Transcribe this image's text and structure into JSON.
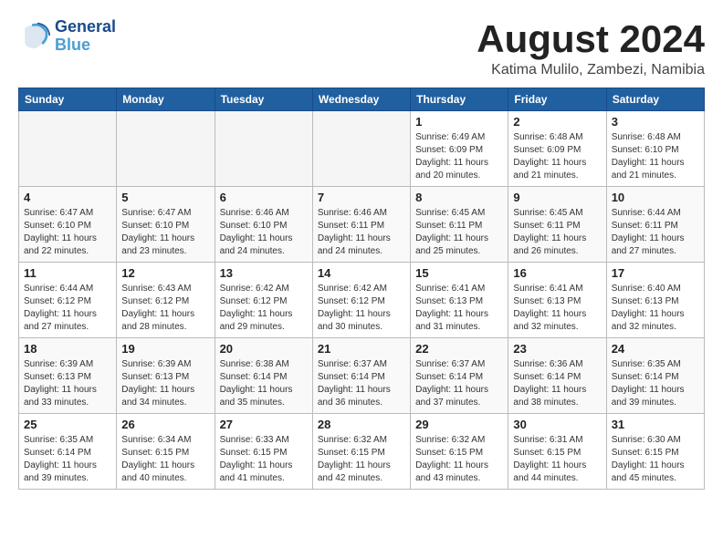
{
  "header": {
    "logo_line1": "General",
    "logo_line2": "Blue",
    "month_title": "August 2024",
    "subtitle": "Katima Mulilo, Zambezi, Namibia"
  },
  "days_of_week": [
    "Sunday",
    "Monday",
    "Tuesday",
    "Wednesday",
    "Thursday",
    "Friday",
    "Saturday"
  ],
  "weeks": [
    [
      {
        "day": "",
        "info": ""
      },
      {
        "day": "",
        "info": ""
      },
      {
        "day": "",
        "info": ""
      },
      {
        "day": "",
        "info": ""
      },
      {
        "day": "1",
        "info": "Sunrise: 6:49 AM\nSunset: 6:09 PM\nDaylight: 11 hours\nand 20 minutes."
      },
      {
        "day": "2",
        "info": "Sunrise: 6:48 AM\nSunset: 6:09 PM\nDaylight: 11 hours\nand 21 minutes."
      },
      {
        "day": "3",
        "info": "Sunrise: 6:48 AM\nSunset: 6:10 PM\nDaylight: 11 hours\nand 21 minutes."
      }
    ],
    [
      {
        "day": "4",
        "info": "Sunrise: 6:47 AM\nSunset: 6:10 PM\nDaylight: 11 hours\nand 22 minutes."
      },
      {
        "day": "5",
        "info": "Sunrise: 6:47 AM\nSunset: 6:10 PM\nDaylight: 11 hours\nand 23 minutes."
      },
      {
        "day": "6",
        "info": "Sunrise: 6:46 AM\nSunset: 6:10 PM\nDaylight: 11 hours\nand 24 minutes."
      },
      {
        "day": "7",
        "info": "Sunrise: 6:46 AM\nSunset: 6:11 PM\nDaylight: 11 hours\nand 24 minutes."
      },
      {
        "day": "8",
        "info": "Sunrise: 6:45 AM\nSunset: 6:11 PM\nDaylight: 11 hours\nand 25 minutes."
      },
      {
        "day": "9",
        "info": "Sunrise: 6:45 AM\nSunset: 6:11 PM\nDaylight: 11 hours\nand 26 minutes."
      },
      {
        "day": "10",
        "info": "Sunrise: 6:44 AM\nSunset: 6:11 PM\nDaylight: 11 hours\nand 27 minutes."
      }
    ],
    [
      {
        "day": "11",
        "info": "Sunrise: 6:44 AM\nSunset: 6:12 PM\nDaylight: 11 hours\nand 27 minutes."
      },
      {
        "day": "12",
        "info": "Sunrise: 6:43 AM\nSunset: 6:12 PM\nDaylight: 11 hours\nand 28 minutes."
      },
      {
        "day": "13",
        "info": "Sunrise: 6:42 AM\nSunset: 6:12 PM\nDaylight: 11 hours\nand 29 minutes."
      },
      {
        "day": "14",
        "info": "Sunrise: 6:42 AM\nSunset: 6:12 PM\nDaylight: 11 hours\nand 30 minutes."
      },
      {
        "day": "15",
        "info": "Sunrise: 6:41 AM\nSunset: 6:13 PM\nDaylight: 11 hours\nand 31 minutes."
      },
      {
        "day": "16",
        "info": "Sunrise: 6:41 AM\nSunset: 6:13 PM\nDaylight: 11 hours\nand 32 minutes."
      },
      {
        "day": "17",
        "info": "Sunrise: 6:40 AM\nSunset: 6:13 PM\nDaylight: 11 hours\nand 32 minutes."
      }
    ],
    [
      {
        "day": "18",
        "info": "Sunrise: 6:39 AM\nSunset: 6:13 PM\nDaylight: 11 hours\nand 33 minutes."
      },
      {
        "day": "19",
        "info": "Sunrise: 6:39 AM\nSunset: 6:13 PM\nDaylight: 11 hours\nand 34 minutes."
      },
      {
        "day": "20",
        "info": "Sunrise: 6:38 AM\nSunset: 6:14 PM\nDaylight: 11 hours\nand 35 minutes."
      },
      {
        "day": "21",
        "info": "Sunrise: 6:37 AM\nSunset: 6:14 PM\nDaylight: 11 hours\nand 36 minutes."
      },
      {
        "day": "22",
        "info": "Sunrise: 6:37 AM\nSunset: 6:14 PM\nDaylight: 11 hours\nand 37 minutes."
      },
      {
        "day": "23",
        "info": "Sunrise: 6:36 AM\nSunset: 6:14 PM\nDaylight: 11 hours\nand 38 minutes."
      },
      {
        "day": "24",
        "info": "Sunrise: 6:35 AM\nSunset: 6:14 PM\nDaylight: 11 hours\nand 39 minutes."
      }
    ],
    [
      {
        "day": "25",
        "info": "Sunrise: 6:35 AM\nSunset: 6:14 PM\nDaylight: 11 hours\nand 39 minutes."
      },
      {
        "day": "26",
        "info": "Sunrise: 6:34 AM\nSunset: 6:15 PM\nDaylight: 11 hours\nand 40 minutes."
      },
      {
        "day": "27",
        "info": "Sunrise: 6:33 AM\nSunset: 6:15 PM\nDaylight: 11 hours\nand 41 minutes."
      },
      {
        "day": "28",
        "info": "Sunrise: 6:32 AM\nSunset: 6:15 PM\nDaylight: 11 hours\nand 42 minutes."
      },
      {
        "day": "29",
        "info": "Sunrise: 6:32 AM\nSunset: 6:15 PM\nDaylight: 11 hours\nand 43 minutes."
      },
      {
        "day": "30",
        "info": "Sunrise: 6:31 AM\nSunset: 6:15 PM\nDaylight: 11 hours\nand 44 minutes."
      },
      {
        "day": "31",
        "info": "Sunrise: 6:30 AM\nSunset: 6:15 PM\nDaylight: 11 hours\nand 45 minutes."
      }
    ]
  ]
}
